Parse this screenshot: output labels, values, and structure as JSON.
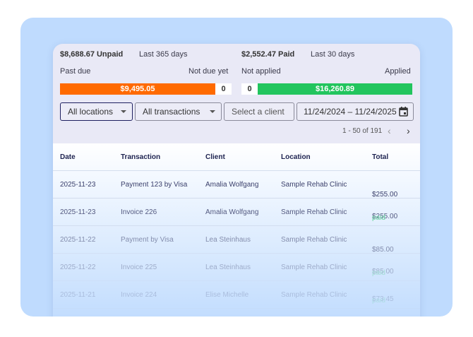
{
  "summary": {
    "unpaid": "$8,688.67 Unpaid",
    "unpaid_period": "Last 365 days",
    "paid": "$2,552.47 Paid",
    "paid_period": "Last 30 days",
    "past_due_label": "Past due",
    "not_due_label": "Not due yet",
    "not_applied_label": "Not applied",
    "applied_label": "Applied",
    "past_due_value": "$9,495.05",
    "not_due_value": "0",
    "not_applied_value": "0",
    "applied_value": "$16,260.89"
  },
  "filters": {
    "location": "All locations",
    "transactions": "All transactions",
    "client_placeholder": "Select a client",
    "date_range": "11/24/2024 – 11/24/2025"
  },
  "pagination": {
    "text": "1 - 50 of 191"
  },
  "colors": {
    "past_due": "#ff6a00",
    "applied": "#22c55e"
  },
  "table": {
    "headers": [
      "Date",
      "Transaction",
      "Client",
      "Location",
      "Total"
    ],
    "rows": [
      {
        "date": "2025-11-23",
        "transaction": "Payment 123 by Visa",
        "client": "Amalia Wolfgang",
        "location": "Sample Rehab Clinic",
        "total": "$255.00",
        "status": ""
      },
      {
        "date": "2025-11-23",
        "transaction": "Invoice 226",
        "client": "Amalia Wolfgang",
        "location": "Sample Rehab Clinic",
        "total": "$255.00",
        "status": "paid"
      },
      {
        "date": "2025-11-22",
        "transaction": "Payment by Visa",
        "client": "Lea Steinhaus",
        "location": "Sample Rehab Clinic",
        "total": "$85.00",
        "status": ""
      },
      {
        "date": "2025-11-22",
        "transaction": "Invoice 225",
        "client": "Lea Steinhaus",
        "location": "Sample Rehab Clinic",
        "total": "$85.00",
        "status": "paid"
      },
      {
        "date": "2025-11-21",
        "transaction": "Invoice 224",
        "client": "Elise Michelle",
        "location": "Sample Rehab Clinic",
        "total": "$73.45",
        "status": "paid"
      }
    ]
  }
}
